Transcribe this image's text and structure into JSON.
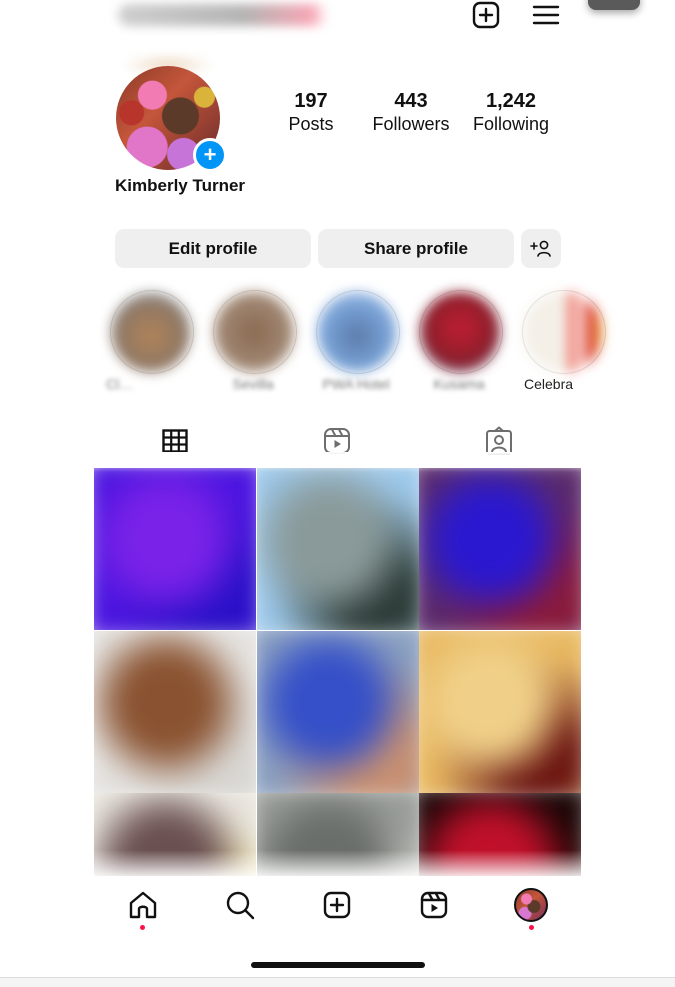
{
  "topbar": {
    "username": "",
    "create_icon": "plus-square-icon",
    "menu_icon": "hamburger-menu-icon"
  },
  "profile": {
    "display_name": "Kimberly Turner",
    "add_story_glyph": "+",
    "stats": [
      {
        "value": "197",
        "label": "Posts"
      },
      {
        "value": "443",
        "label": "Followers"
      },
      {
        "value": "1,242",
        "label": "Following"
      }
    ]
  },
  "actions": {
    "edit_label": "Edit profile",
    "share_label": "Share profile",
    "discover_icon": "add-person-icon"
  },
  "highlights": [
    {
      "label": "Cl…",
      "blurred": true
    },
    {
      "label": "Sevilla",
      "blurred": true
    },
    {
      "label": "PWA Hotel",
      "blurred": true
    },
    {
      "label": "Kusama",
      "blurred": true
    },
    {
      "label": "Celebra",
      "blurred": false
    }
  ],
  "tabs": [
    {
      "name": "posts",
      "icon": "grid-icon",
      "active": true
    },
    {
      "name": "reels",
      "icon": "reels-icon",
      "active": false
    },
    {
      "name": "tagged",
      "icon": "tagged-person-icon",
      "active": false
    }
  ],
  "grid_posts": [
    {
      "colors": [
        "#4a14e0",
        "#7a22e8",
        "#2a10c8"
      ]
    },
    {
      "colors": [
        "#9cc8ea",
        "#8a9a9a",
        "#2b3a36"
      ]
    },
    {
      "colors": [
        "#5a2a6a",
        "#2a18d0",
        "#8a1a3a"
      ]
    },
    {
      "colors": [
        "#e4e2df",
        "#8a5230",
        "#d8d6d2"
      ]
    },
    {
      "colors": [
        "#8aa0c0",
        "#3550c8",
        "#c89070"
      ]
    },
    {
      "colors": [
        "#e8b860",
        "#f0d088",
        "#6a1410"
      ]
    },
    {
      "colors": [
        "#e8e4dc",
        "#6a5050",
        "#e8d890"
      ]
    },
    {
      "colors": [
        "#9a9e9a",
        "#6a6e6a",
        "#d8d8d0"
      ]
    },
    {
      "colors": [
        "#1a0606",
        "#c0102a",
        "#3a0606"
      ]
    }
  ],
  "bottom_nav": [
    {
      "name": "home",
      "icon": "home-icon",
      "dot": true
    },
    {
      "name": "search",
      "icon": "search-icon",
      "dot": false
    },
    {
      "name": "create",
      "icon": "plus-square-icon",
      "dot": false
    },
    {
      "name": "reels",
      "icon": "reels-icon",
      "dot": false
    },
    {
      "name": "profile",
      "icon": "profile-avatar",
      "dot": true
    }
  ],
  "colors": {
    "accent_blue": "#0095f6",
    "notification_red": "#ff0f47",
    "button_gray": "#efefef"
  }
}
